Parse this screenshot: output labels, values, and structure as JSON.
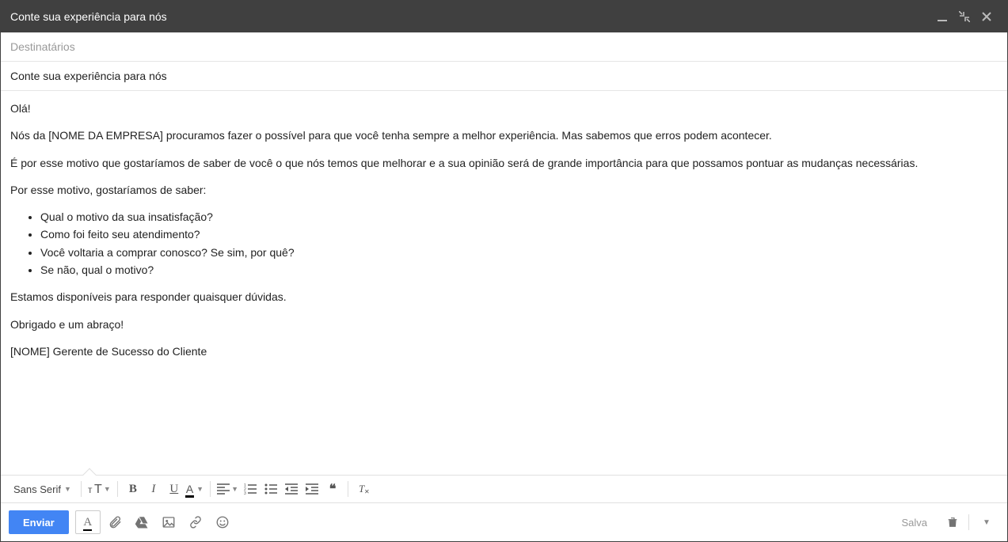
{
  "window": {
    "title": "Conte sua experiência para nós"
  },
  "recipients": {
    "placeholder": "Destinatários",
    "value": ""
  },
  "subject": {
    "value": "Conte sua experiência para nós"
  },
  "body": {
    "p1": "Olá!",
    "p2": "Nós da [NOME DA EMPRESA] procuramos fazer o possível para que você tenha sempre a melhor experiência. Mas sabemos que erros podem acontecer.",
    "p3": "É por esse motivo que gostaríamos de saber de você o que nós temos que melhorar e a sua opinião será de grande importância para que possamos pontuar as mudanças necessárias.",
    "p4": "Por esse motivo, gostaríamos de saber:",
    "bullets": [
      "Qual o motivo da sua insatisfação?",
      "Como foi feito seu atendimento?",
      "Você voltaria a comprar conosco? Se sim, por quê?",
      "Se não, qual o motivo?"
    ],
    "p5": "Estamos disponíveis para responder quaisquer dúvidas.",
    "p6": "Obrigado e um abraço!",
    "p7": "[NOME] Gerente de Sucesso do Cliente"
  },
  "format_toolbar": {
    "font": "Sans Serif"
  },
  "bottom": {
    "send": "Enviar",
    "status": "Salva"
  },
  "icons": {
    "minimize": "minimize-icon",
    "expand": "expand-icon",
    "close": "close-icon"
  }
}
